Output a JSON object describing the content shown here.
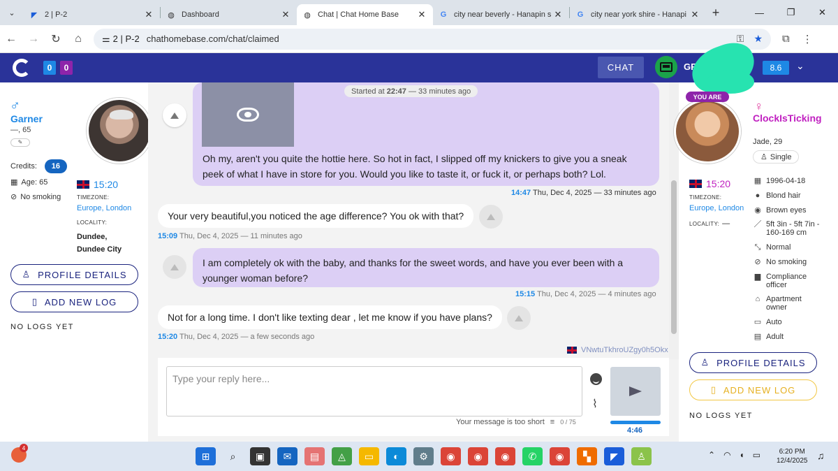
{
  "browser": {
    "tabs": [
      {
        "label": "2 | P-2",
        "icon": "chathome-icon",
        "active": false
      },
      {
        "label": "Dashboard",
        "icon": "globe-icon",
        "active": false
      },
      {
        "label": "Chat | Chat Home Base",
        "icon": "globe-icon",
        "active": true
      },
      {
        "label": "city near beverly - Hanapin s",
        "icon": "google-icon",
        "active": false
      },
      {
        "label": "city near york shire - Hanapi",
        "icon": "google-icon",
        "active": false
      }
    ],
    "site_label": "2 | P-2",
    "url": "chathomebase.com/chat/claimed"
  },
  "header": {
    "counter_blue": "0",
    "counter_purple": "0",
    "chat_button": "CHAT",
    "username_partial": "GF",
    "score": "8.6",
    "brand_color": "#2a3399"
  },
  "customer": {
    "name": "Garner",
    "age_line": "—, 65",
    "credits_label": "Credits:",
    "credits": "16",
    "age_label": "Age: 65",
    "smoking": "No smoking",
    "time": "15:20",
    "timezone_label": "TIMEZONE:",
    "timezone": "Europe, London",
    "locality_label": "LOCALITY:",
    "locality_line1": "Dundee,",
    "locality_line2": "Dundee City",
    "profile_button": "PROFILE DETAILS",
    "log_button": "ADD NEW LOG",
    "no_logs": "NO LOGS YET"
  },
  "chat": {
    "started": "Started at",
    "started_time": "22:47",
    "started_ago": "— 33 minutes ago",
    "messages": [
      {
        "dir": "out",
        "text": "Oh my, aren't you quite the hottie here. So hot in fact, I slipped off my knickers to give you a sneak peek of what I have in store for you. Would you like to taste it, or fuck it, or perhaps both? Lol.",
        "time": "14:47",
        "date": "Thu, Dec 4, 2025 — 33 minutes ago"
      },
      {
        "dir": "in",
        "text": "Your very beautiful,you noticed the age difference? You ok with that?",
        "time": "15:09",
        "date": "Thu, Dec 4, 2025 — 11 minutes ago"
      },
      {
        "dir": "out",
        "text": "I am completely ok with the baby, and thanks for the sweet words, and have you ever been with a younger woman before?",
        "time": "15:15",
        "date": "Thu, Dec 4, 2025 — 4 minutes ago"
      },
      {
        "dir": "in",
        "text": "Not for a long time. I don't like texting dear , let me know if you have plans?",
        "time": "15:20",
        "date": "Thu, Dec 4, 2025 — a few seconds ago"
      }
    ],
    "session_id": "VNwtuTkhroUZgy0h5Okx",
    "reply_placeholder": "Type your reply here...",
    "too_short": "Your message is too short",
    "char_count": "0 / 75",
    "timer": "4:46",
    "timer_progress": 1.0
  },
  "profile": {
    "you_are": "YOU ARE",
    "name": "ClockIsTicking",
    "age_line": "Jade, 29",
    "status": "Single",
    "time": "15:20",
    "timezone_label": "TIMEZONE:",
    "timezone": "Europe, London",
    "locality_label": "LOCALITY:",
    "locality": "—",
    "attributes": [
      {
        "icon": "calendar-icon",
        "glyph": "▦",
        "text": "1996-04-18"
      },
      {
        "icon": "hair-icon",
        "glyph": "●",
        "text": "Blond hair"
      },
      {
        "icon": "eye-icon",
        "glyph": "◉",
        "text": "Brown eyes"
      },
      {
        "icon": "ruler-icon",
        "glyph": "／",
        "text": "5ft 3in - 5ft 7in - 160-169 cm"
      },
      {
        "icon": "body-icon",
        "glyph": "⤡",
        "text": "Normal"
      },
      {
        "icon": "no-smoking-icon",
        "glyph": "⊘",
        "text": "No smoking"
      },
      {
        "icon": "briefcase-icon",
        "glyph": "▆",
        "text": "Compliance officer"
      },
      {
        "icon": "home-icon",
        "glyph": "⌂",
        "text": "Apartment owner"
      },
      {
        "icon": "car-icon",
        "glyph": "▭",
        "text": "Auto"
      },
      {
        "icon": "adult-icon",
        "glyph": "▤",
        "text": "Adult"
      }
    ],
    "profile_button": "PROFILE DETAILS",
    "log_button": "ADD NEW LOG",
    "no_logs": "NO LOGS YET"
  },
  "taskbar": {
    "weather_badge": "4",
    "time": "6:20 PM",
    "date": "12/4/2025"
  }
}
